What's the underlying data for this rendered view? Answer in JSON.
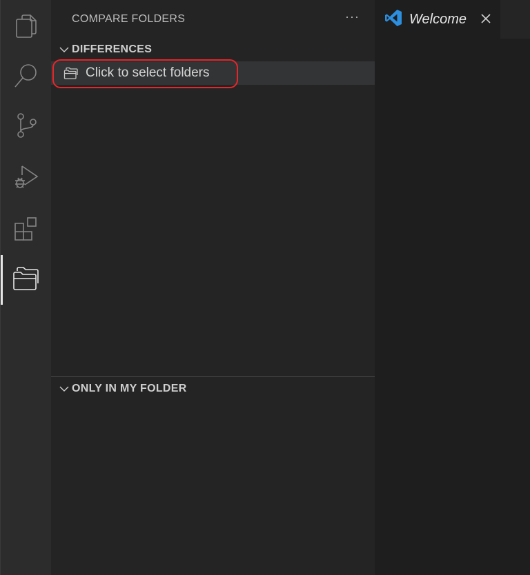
{
  "activity_bar": {
    "items": [
      {
        "icon": "explorer-icon"
      },
      {
        "icon": "search-icon"
      },
      {
        "icon": "source-control-icon"
      },
      {
        "icon": "run-debug-icon"
      },
      {
        "icon": "extensions-icon"
      },
      {
        "icon": "compare-folders-icon",
        "active": true
      }
    ]
  },
  "sidebar": {
    "title": "COMPARE FOLDERS",
    "more_label": "···",
    "sections": [
      {
        "title": "DIFFERENCES",
        "expanded": true,
        "items": [
          {
            "icon": "folder-icon",
            "label": "Click to select folders"
          }
        ]
      },
      {
        "title": "ONLY IN MY FOLDER",
        "expanded": true,
        "items": []
      }
    ]
  },
  "editor": {
    "tabs": [
      {
        "icon": "vscode-logo-icon",
        "title": "Welcome",
        "italic": true
      }
    ]
  },
  "colors": {
    "highlight": "#e8262a",
    "vscode_blue": "#2d8fe0",
    "activity_bar_bg": "#2c2c2c",
    "sidebar_bg": "#242424"
  }
}
